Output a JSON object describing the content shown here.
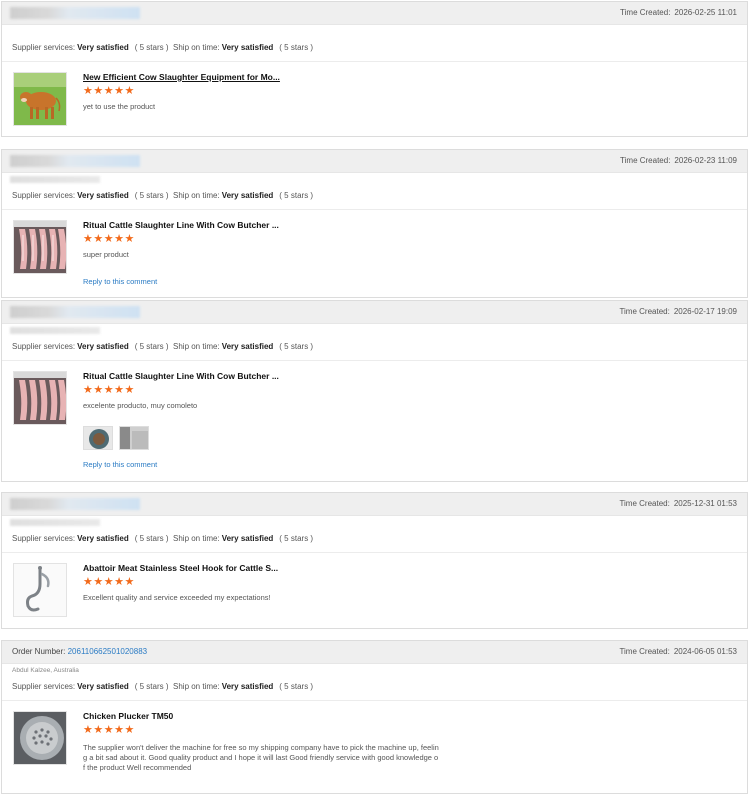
{
  "reviews": [
    {
      "time_label": "Time Created:",
      "time": "2026-02-25 11:01",
      "supplier_label": "Supplier services:",
      "supplier_value": "Very satisfied",
      "supplier_stars": "( 5 stars )",
      "ship_label": "Ship on time:",
      "ship_value": "Very satisfied",
      "ship_stars": "( 5 stars )",
      "product_title": "New Efficient Cow Slaughter Equipment for Mo...",
      "stars": "★★★★★",
      "comment": "yet to use the product",
      "thumb_icon": "cow-photo"
    },
    {
      "time_label": "Time Created:",
      "time": "2026-02-23 11:09",
      "supplier_label": "Supplier services:",
      "supplier_value": "Very satisfied",
      "supplier_stars": "( 5 stars )",
      "ship_label": "Ship on time:",
      "ship_value": "Very satisfied",
      "ship_stars": "( 5 stars )",
      "product_title": "Ritual Cattle Slaughter Line With Cow Butcher ...",
      "stars": "★★★★★",
      "comment": "super product",
      "reply": "Reply to this comment",
      "thumb_icon": "carcass-photo"
    },
    {
      "time_label": "Time Created:",
      "time": "2026-02-17 19:09",
      "supplier_label": "Supplier services:",
      "supplier_value": "Very satisfied",
      "supplier_stars": "( 5 stars )",
      "ship_label": "Ship on time:",
      "ship_value": "Very satisfied",
      "ship_stars": "( 5 stars )",
      "product_title": "Ritual Cattle Slaughter Line With Cow Butcher ...",
      "stars": "★★★★★",
      "comment": "excelente producto, muy comoleto",
      "reply": "Reply to this comment",
      "thumb_icon": "carcass-photo"
    },
    {
      "time_label": "Time Created:",
      "time": "2025-12-31 01:53",
      "supplier_label": "Supplier services:",
      "supplier_value": "Very satisfied",
      "supplier_stars": "( 5 stars )",
      "ship_label": "Ship on time:",
      "ship_value": "Very satisfied",
      "ship_stars": "( 5 stars )",
      "product_title": "Abattoir Meat Stainless Steel Hook for Cattle S...",
      "stars": "★★★★★",
      "comment": "Excellent quality and service exceeded my expectations!",
      "thumb_icon": "hook-photo"
    },
    {
      "order_label": "Order Number:",
      "order_number": "206110662501020883",
      "time_label": "Time Created:",
      "time": "2024-06-05 01:53",
      "buyer": "Abdul Kalzee, Australia",
      "supplier_label": "Supplier services:",
      "supplier_value": "Very satisfied",
      "supplier_stars": "( 5 stars )",
      "ship_label": "Ship on time:",
      "ship_value": "Very satisfied",
      "ship_stars": "( 5 stars )",
      "product_title": "Chicken Plucker TM50",
      "stars": "★★★★★",
      "comment": "The supplier won't deliver the machine for free so my shipping company have to pick the machine up, feelin g a bit sad about it. Good quality product and I hope it will last Good friendly service with good knowledge o f the product Well recommended",
      "thumb_icon": "plucker-photo"
    }
  ],
  "colors": {
    "accent_star": "#f26a1b",
    "link": "#2a7bc4",
    "header_bg": "#efefef"
  }
}
